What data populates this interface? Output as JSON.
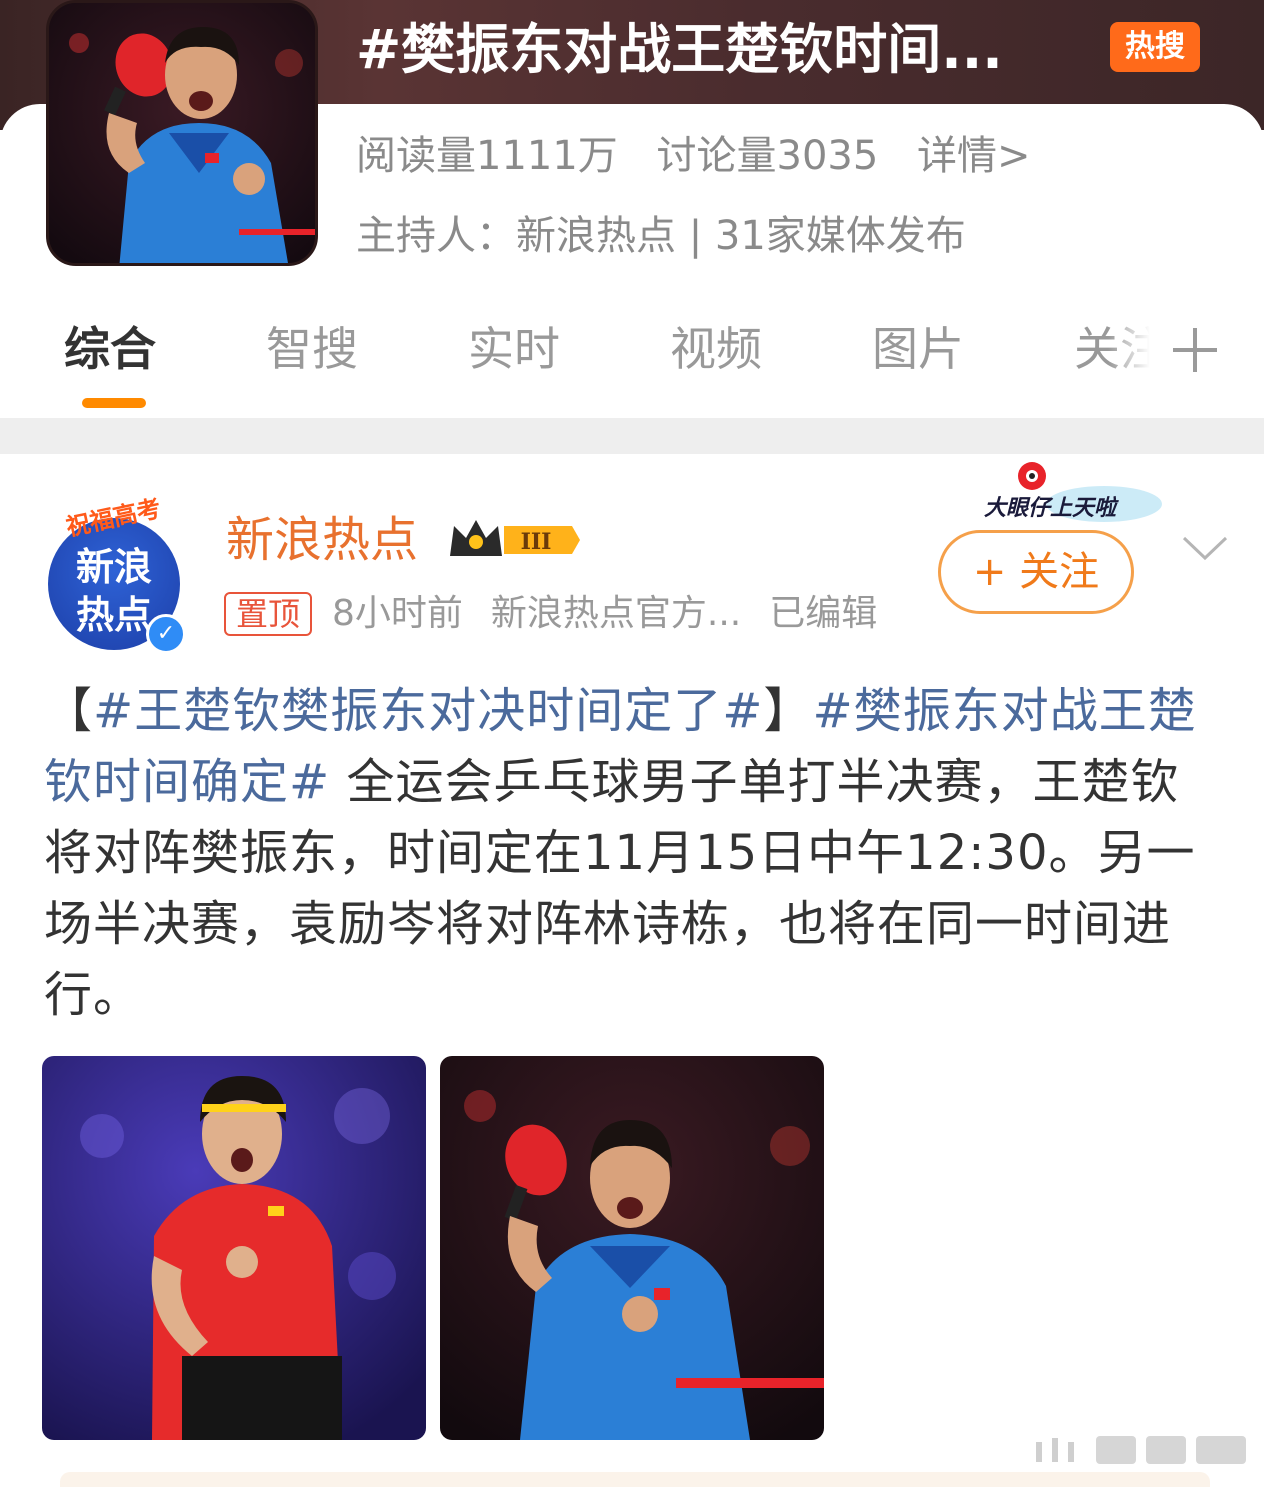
{
  "header": {
    "title": "#樊振东对战王楚钦时间...",
    "hot_badge": "热搜",
    "read_count": "阅读量1111万",
    "discuss_count": "讨论量3035",
    "detail_link": "详情>",
    "host_line": "主持人：新浪热点 | 31家媒体发布"
  },
  "tabs": [
    {
      "label": "综合",
      "active": true
    },
    {
      "label": "智搜",
      "active": false
    },
    {
      "label": "实时",
      "active": false
    },
    {
      "label": "视频",
      "active": false
    },
    {
      "label": "图片",
      "active": false
    },
    {
      "label": "关注",
      "active": false
    }
  ],
  "post": {
    "avatar": {
      "banner": "祝福高考",
      "line1": "新浪",
      "line2": "热点"
    },
    "author": "新浪热点",
    "level_badge": "III",
    "pin": "置顶",
    "time": "8小时前",
    "source": "新浪热点官方...",
    "edited": "已编辑",
    "event_sticker": "大眼仔上天啦",
    "follow_label": "+ 关注",
    "text": {
      "bracket_open": "【",
      "tag1": "#王楚钦樊振东对决时间定了#",
      "bracket_close": "】",
      "tag2": "#樊振东对战王楚钦时间确定#",
      "body": " 全运会乒乓球男子单打半决赛，王楚钦将对阵樊振东，时间定在11月15日中午12:30。另一场半决赛，袁励岑将对阵林诗栋，也将在同一时间进行。"
    }
  },
  "colors": {
    "accent": "#ff8a00",
    "author": "#e8712e",
    "hashtag": "#4b6a9c",
    "hot_badge": "#ff6a1a",
    "pin": "#e8543a"
  },
  "icons": [
    "add-tab-icon",
    "chevron-down-icon",
    "crown-icon",
    "verified-icon"
  ]
}
